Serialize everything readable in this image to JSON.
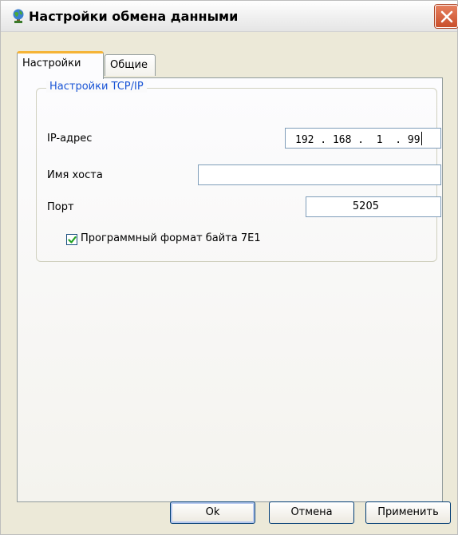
{
  "window": {
    "title": "Настройки обмена данными",
    "icon": "globe-app-icon",
    "close_icon": "close-icon"
  },
  "tabs": [
    {
      "label": "Настройки",
      "active": true
    },
    {
      "label": "Общие",
      "active": false
    }
  ],
  "tcpip": {
    "group_title": "Настройки TCP/IP",
    "ip_label": "IP-адрес",
    "ip_value": "192 . 168 .  1  . 99",
    "host_label": "Имя хоста",
    "host_value": "",
    "port_label": "Порт",
    "port_value": "5205",
    "checkbox_label": "Программный формат байта 7E1",
    "checkbox_checked": true
  },
  "buttons": {
    "ok": "Ok",
    "cancel": "Отмена",
    "apply": "Применить"
  },
  "colors": {
    "accent_blue": "#1954d6",
    "close_red": "#c94f2b",
    "tab_highlight": "#f5b437",
    "check_green": "#21a121"
  }
}
